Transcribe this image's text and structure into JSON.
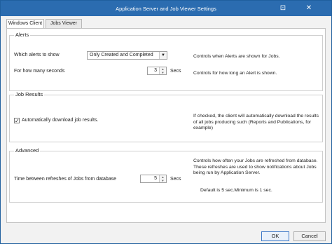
{
  "window": {
    "title": "Application Server and Job Viewer Settings"
  },
  "tabs": [
    {
      "label": "Windows Client"
    },
    {
      "label": "Jobs Viewer"
    }
  ],
  "alerts": {
    "title": "Alerts",
    "which_label": "Which alerts to show",
    "which_value": "Only Created and Completed",
    "which_desc": "Controls when Alerts are shown for Jobs.",
    "seconds_label": "For how many seconds",
    "seconds_value": "3",
    "seconds_unit": "Secs",
    "seconds_desc": "Controls for how long an Alert is shown."
  },
  "job_results": {
    "title": "Job Results",
    "auto_download_label": "Automatically download job results.",
    "auto_download_checked": "✓",
    "desc": "If checked, the client will automatically download the results of all jobs producing such (Reports and Publications, for example)"
  },
  "advanced": {
    "title": "Advanced",
    "refresh_label": "Time between refreshes of Jobs from database",
    "refresh_value": "5",
    "refresh_unit": "Secs",
    "desc": "Controls how often your Jobs are refreshed from database. These refreshes are used to show notifications about Jobs being run by Application Server.",
    "default_note": "Default is 5 sec.Minimum is 1 sec."
  },
  "buttons": {
    "ok": "OK",
    "cancel": "Cancel"
  },
  "icons": {
    "settings_box": "⊡",
    "close": "✕"
  },
  "colors": {
    "titlebar": "#2b6cb0"
  }
}
